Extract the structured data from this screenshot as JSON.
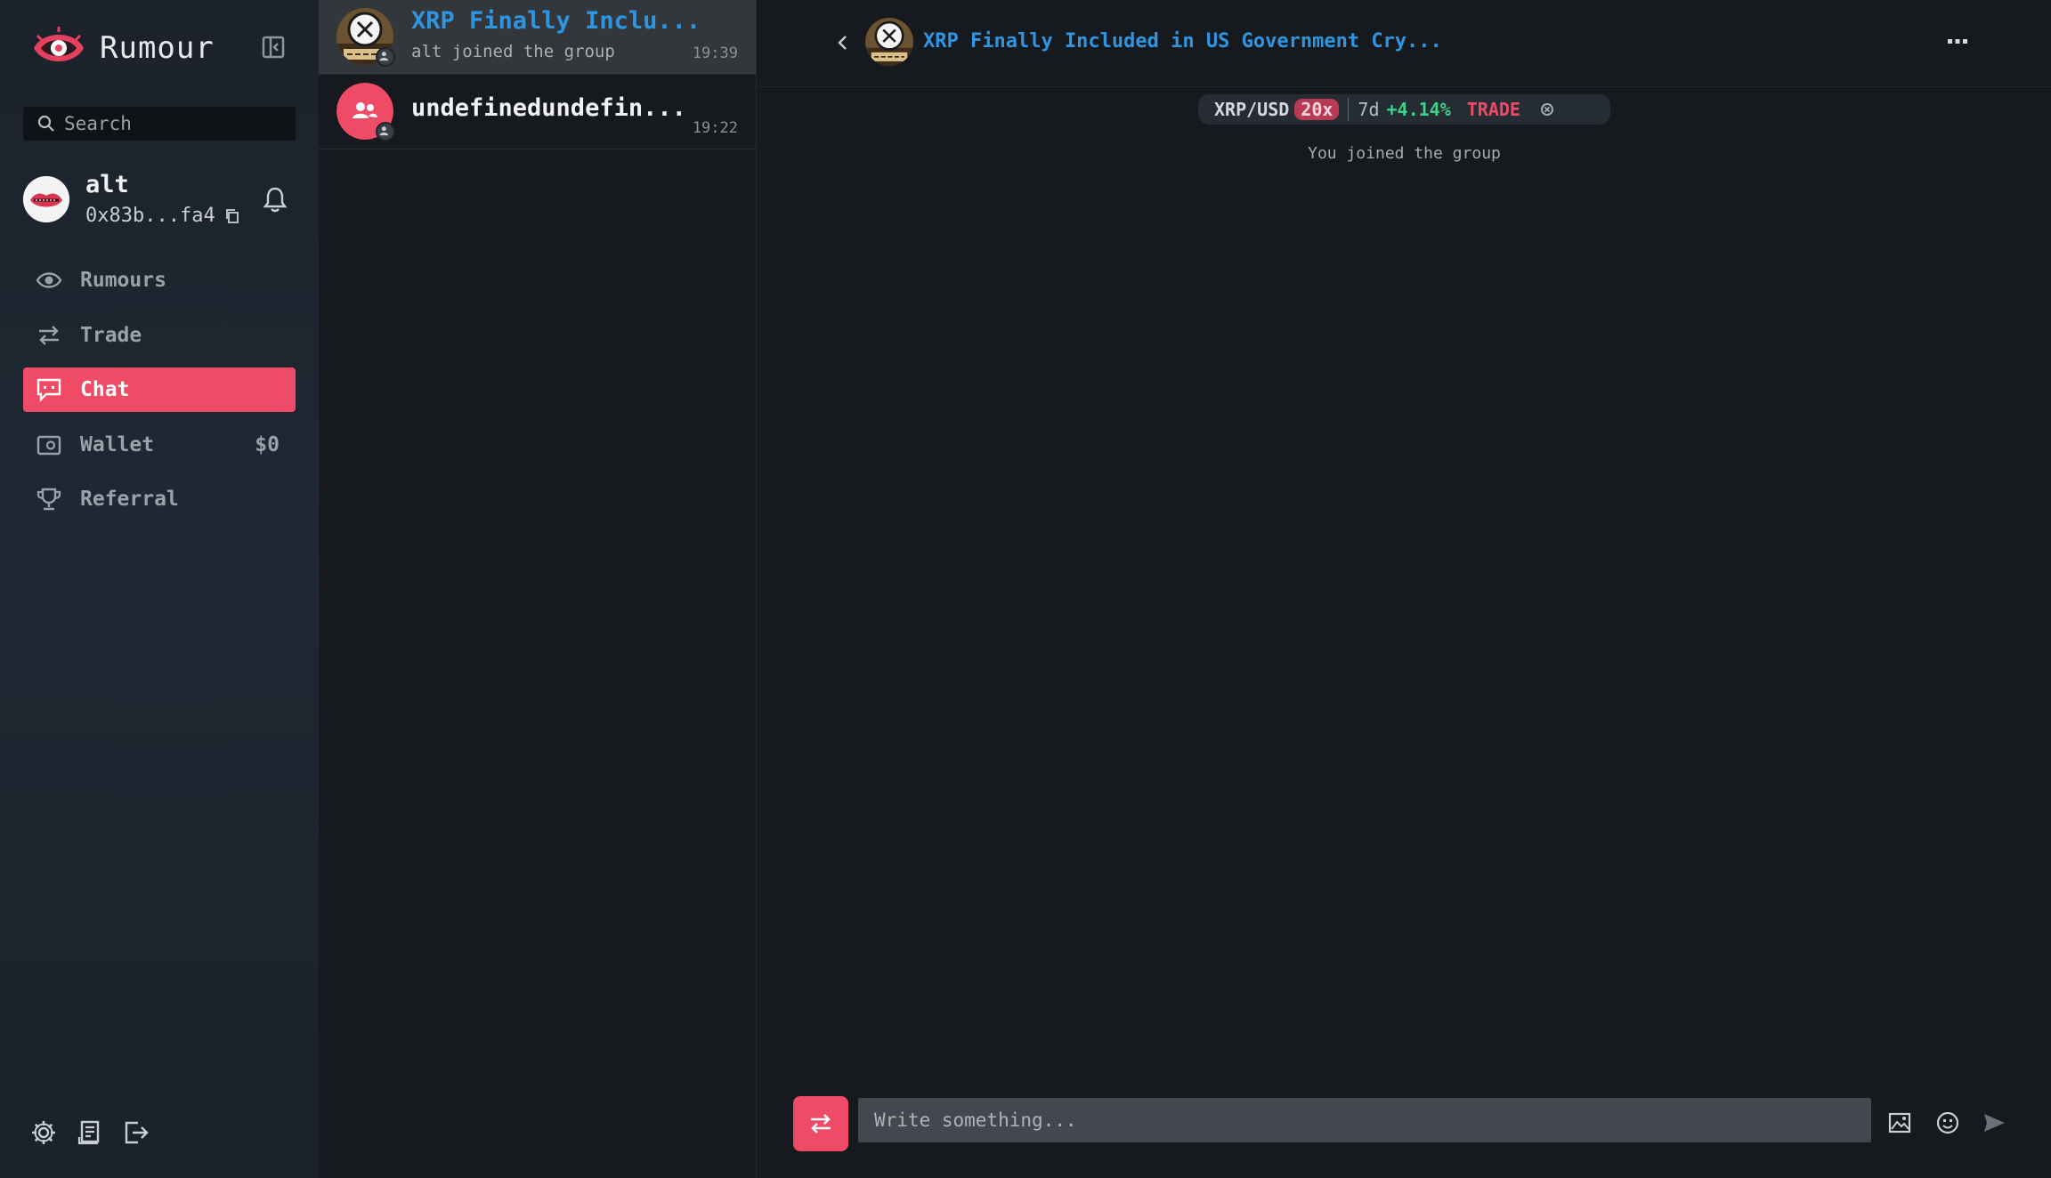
{
  "brand": {
    "name": "Rumour"
  },
  "search": {
    "placeholder": "Search"
  },
  "profile": {
    "name": "alt",
    "address": "0x83b...fa4"
  },
  "nav": {
    "items": [
      {
        "label": "Rumours",
        "icon": "eye-icon"
      },
      {
        "label": "Trade",
        "icon": "swap-icon"
      },
      {
        "label": "Chat",
        "icon": "chat-icon",
        "active": true
      },
      {
        "label": "Wallet",
        "icon": "wallet-icon",
        "amount": "$0"
      },
      {
        "label": "Referral",
        "icon": "trophy-icon"
      }
    ]
  },
  "conversations": [
    {
      "title": "XRP Finally Inclu...",
      "last_message": "alt joined the group",
      "time": "19:39",
      "active": true
    },
    {
      "title": "undefinedundefin...",
      "last_message": "",
      "time": "19:22",
      "active": false
    }
  ],
  "chat": {
    "title": "XRP Finally Included in US Government Cry...",
    "ticker": {
      "pair": "XRP/USD",
      "leverage": "20x",
      "period": "7d",
      "change": "+4.14%",
      "action": "TRADE"
    },
    "system_message": "You joined the group",
    "composer_placeholder": "Write something..."
  },
  "colors": {
    "accent": "#ef4a66",
    "link": "#2f95e0",
    "positive": "#3fd08a"
  }
}
